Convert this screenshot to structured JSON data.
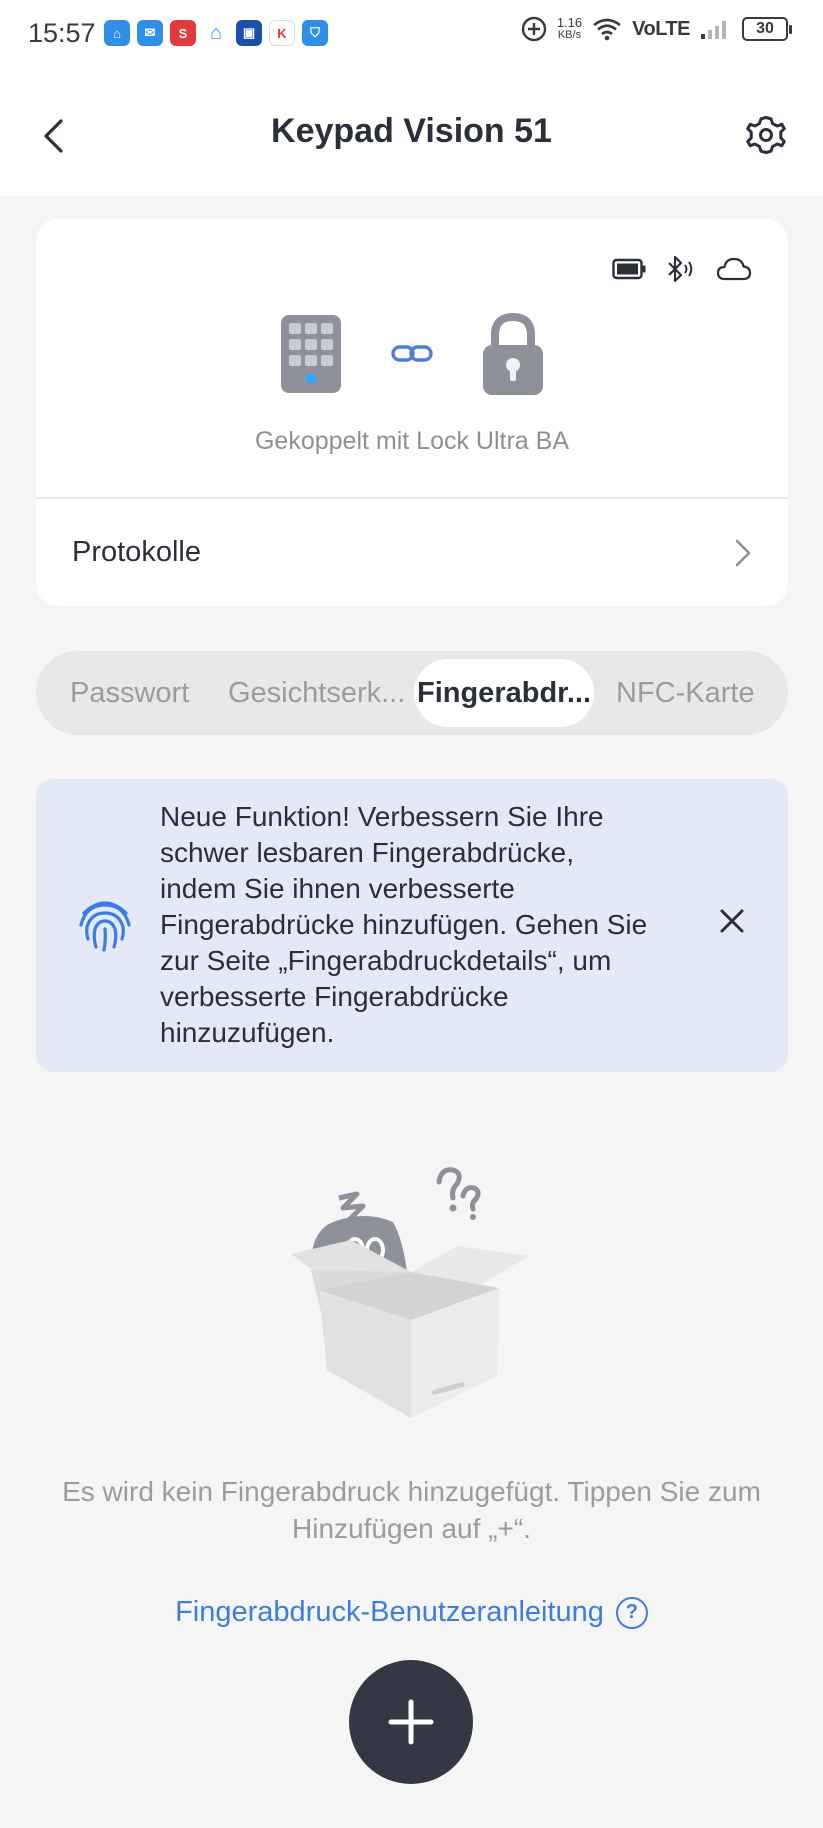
{
  "status_bar": {
    "time": "15:57",
    "speed_value": "1.16",
    "speed_unit": "KB/s",
    "network": "VoLTE",
    "battery": "30"
  },
  "header": {
    "title": "Keypad Vision 51"
  },
  "device_card": {
    "paired_text": "Gekoppelt mit Lock Ultra BA",
    "logs_label": "Protokolle"
  },
  "tabs": [
    {
      "label": "Passwort",
      "active": false
    },
    {
      "label": "Gesichtserk...",
      "active": false
    },
    {
      "label": "Fingerabdr...",
      "active": true
    },
    {
      "label": "NFC-Karte",
      "active": false
    }
  ],
  "banner": {
    "text": "Neue Funktion! Verbessern Sie Ihre schwer lesbaren Fingerabdrücke, indem Sie ihnen verbesserte Fingerabdrücke hinzufügen. Gehen Sie zur Seite „Fingerabdruckdetails“, um verbesserte Fingerabdrücke hinzuzufügen."
  },
  "empty_state": {
    "text": "Es wird kein Fingerabdruck hinzugefügt. Tippen Sie zum Hinzufügen auf „+“.",
    "guide_link": "Fingerabdruck-Benutzeranleitung",
    "guide_icon": "?"
  },
  "colors": {
    "accent": "#3d7de0",
    "fab": "#333844",
    "banner_bg": "#e3e9f6"
  }
}
